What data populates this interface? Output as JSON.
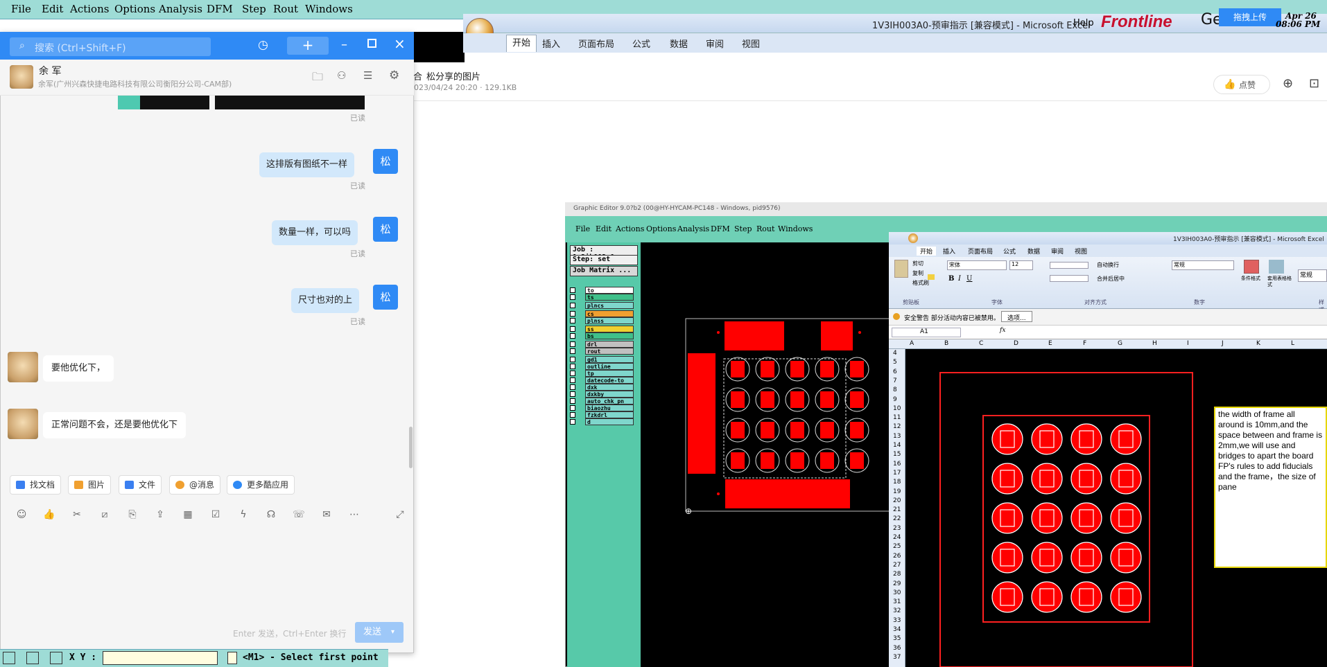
{
  "cam": {
    "menu": [
      "File",
      "Edit",
      "Actions",
      "Options",
      "Analysis",
      "DFM",
      "Step",
      "Rout",
      "Windows"
    ],
    "help": "Help",
    "brand": "Frontline",
    "brand_suffix": "Ge",
    "clock_date": "Apr 26",
    "clock_time": "08:06 PM",
    "status_xy_label": "X Y :",
    "status_message": "<M1> - Select first point"
  },
  "excel": {
    "title": "1V3IH003A0-预审指示  [兼容模式] - Microsoft Excel",
    "tabs": [
      "开始",
      "插入",
      "页面布局",
      "公式",
      "数据",
      "审阅",
      "视图"
    ],
    "upload_btn": "拖拽上传"
  },
  "viewer": {
    "title": "松分享的图片",
    "title_prefix": "合",
    "meta": "2023/04/24 20:20 · 129.1KB",
    "like": "点赞"
  },
  "shot": {
    "title": "Graphic Editor 9.0?b2 (00@HY-HYCAM-PC148 - Windows, pid9576)",
    "menu": [
      "File",
      "Edit",
      "Actions",
      "Options",
      "Analysis",
      "DFM",
      "Step",
      "Rout",
      "Windows"
    ],
    "help": "Help",
    "job": "Job : 1v3ih003a0",
    "step": "Step: set",
    "job_matrix": "Job Matrix ...",
    "layers": [
      "to",
      "ts",
      "plncs",
      "cs",
      "plnss",
      "ss",
      "bs",
      "drl",
      "rout",
      "gd1",
      "outline",
      "tp",
      "datecode-to",
      "dxk",
      "dxkby",
      "auto_chk_pn",
      "biaozhu",
      "fzkdrl",
      "d"
    ],
    "layer_colors": [
      "#ffffff",
      "#3fc08a",
      "#7fd6cc",
      "#f0a030",
      "#7fd6cc",
      "#f0d030",
      "#3fc08a",
      "#c0c0c0",
      "#c0c0c0",
      "#7fd6cc",
      "#7fd6cc",
      "#7fd6cc",
      "#7fd6cc",
      "#7fd6cc",
      "#7fd6cc",
      "#7fd6cc",
      "#7fd6cc",
      "#7fd6cc",
      "#7fd6cc"
    ],
    "excel_title": "1V3IH003A0-预审指示  [兼容模式] - Microsoft Excel",
    "excel_tabs": [
      "开始",
      "插入",
      "页面布局",
      "公式",
      "数据",
      "审阅",
      "视图"
    ],
    "font_name": "宋体",
    "font_size": "12",
    "number_format": "常规",
    "ribbon_items": [
      "剪切",
      "复制",
      "格式刷",
      "自动换行",
      "合并后居中",
      "条件格式",
      "套用表格格式",
      "常规"
    ],
    "groups": [
      "剪贴板",
      "字体",
      "对齐方式",
      "数字",
      "样式"
    ],
    "security_warning": "安全警告  部分活动内容已被禁用。",
    "options_btn": "选项...",
    "cell_ref": "A1",
    "columns": [
      "A",
      "B",
      "C",
      "D",
      "E",
      "F",
      "G",
      "H",
      "I",
      "J",
      "K",
      "L"
    ],
    "rows": [
      "4",
      "5",
      "6",
      "7",
      "8",
      "9",
      "10",
      "11",
      "12",
      "13",
      "14",
      "15",
      "16",
      "17",
      "18",
      "19",
      "20",
      "21",
      "22",
      "23",
      "24",
      "25",
      "26",
      "27",
      "28",
      "29",
      "30",
      "31",
      "32",
      "33",
      "34",
      "35",
      "36",
      "37"
    ],
    "note": "the width of frame all around is 10mm,and the space between and frame is 2mm,we will use and bridges to apart the board FP's rules to add fiducials and the frame，the size of pane"
  },
  "chat": {
    "search_placeholder": "搜索 (Ctrl+Shift+F)",
    "contact_name": "余 军",
    "contact_org": "余军(广州兴森快捷电路科技有限公司衡阳分公司-CAM部)",
    "read_label": "已读",
    "my_avatar": "松",
    "messages_out": [
      "这排版有图纸不一样",
      "数量一样，可以吗",
      "尺寸也对的上"
    ],
    "messages_in": [
      "要他优化下，",
      "正常问题不会，还是要他优化下"
    ],
    "chips": [
      "找文档",
      "图片",
      "文件",
      "@消息",
      "更多酷应用"
    ],
    "input_hint": "Enter 发送，Ctrl+Enter 换行",
    "send": "发送"
  }
}
